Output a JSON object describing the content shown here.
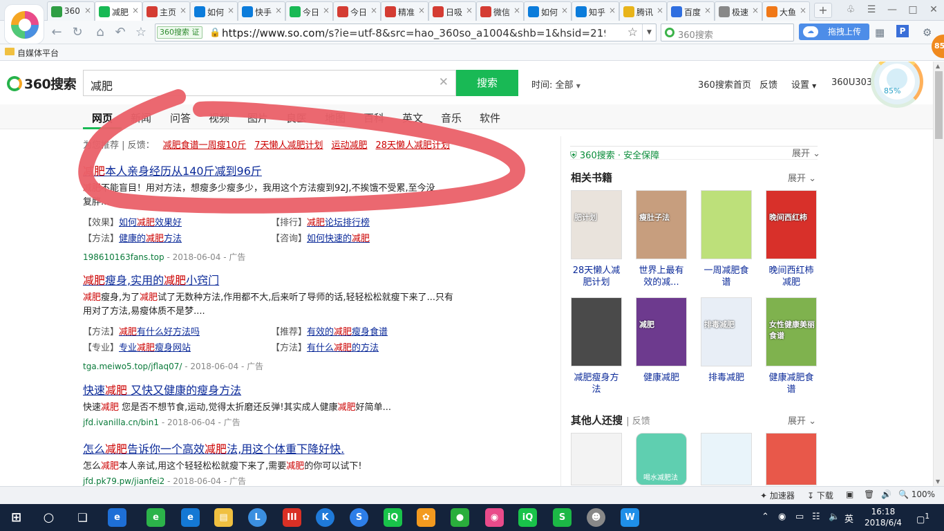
{
  "browser": {
    "tabs": [
      {
        "label": "360",
        "icon": "360-shield-icon",
        "color": "#2f9e44"
      },
      {
        "label": "减肥",
        "icon": "360-search-icon",
        "color": "#19b955",
        "active": true
      },
      {
        "label": "主页",
        "icon": "toutiao-icon",
        "color": "#d43c33"
      },
      {
        "label": "如何",
        "icon": "zhihu-icon",
        "color": "#0b7cdb"
      },
      {
        "label": "快手",
        "icon": "zhihu-icon",
        "color": "#0b7cdb"
      },
      {
        "label": "今日",
        "icon": "360-search-icon",
        "color": "#19b955"
      },
      {
        "label": "今日",
        "icon": "toutiao-icon",
        "color": "#d43c33"
      },
      {
        "label": "精准",
        "icon": "toutiao-icon",
        "color": "#d43c33"
      },
      {
        "label": "日吸",
        "icon": "toutiao-icon",
        "color": "#d43c33"
      },
      {
        "label": "微信",
        "icon": "toutiao-icon",
        "color": "#d43c33"
      },
      {
        "label": "如何",
        "icon": "zhihu-icon",
        "color": "#0b7cdb"
      },
      {
        "label": "知乎",
        "icon": "zhihu-icon",
        "color": "#0b7cdb"
      },
      {
        "label": "腾讯",
        "icon": "qq-icon",
        "color": "#e8b41a"
      },
      {
        "label": "百度",
        "icon": "baidu-icon",
        "color": "#2f6ee0"
      },
      {
        "label": "极速",
        "icon": "page-icon",
        "color": "#888888"
      },
      {
        "label": "大鱼",
        "icon": "dayu-icon",
        "color": "#f07818"
      }
    ],
    "new_tab": "+",
    "address": {
      "badge": "360搜索 证",
      "url_prefix": "https://www.so.com",
      "url_rest": "/s?ie=utf-8&src=hao_360so_a1004&shb=1&hsid=219d8"
    },
    "search_placeholder": "360搜索",
    "upload_label": "拖拽上传",
    "bookmark_label": "自媒体平台",
    "orange_badge": "85"
  },
  "search": {
    "logo_text": "360搜索",
    "query": "减肥",
    "button": "搜索",
    "time_label": "时间:",
    "time_value": "全部",
    "links": [
      "360搜索首页",
      "反馈",
      "设置",
      "360U3036..."
    ],
    "assistant_pct": "85%",
    "tabs": [
      "网页",
      "新闻",
      "问答",
      "视频",
      "图片",
      "良医",
      "地图",
      "百科",
      "英文",
      "音乐",
      "软件"
    ],
    "related_prefix": "为您推荐 | 反馈：",
    "related": [
      "减肥食谱一周瘦10斤",
      "7天懒人减肥计划",
      "运动减肥",
      "28天懒人减肥计划"
    ]
  },
  "results": [
    {
      "title": "减肥本人亲身经历从140斤减到96斤",
      "desc": "减肥不能盲目！用对方法，想瘦多少瘦多少，我用这个方法瘦到92J,不挨饿不受累,至今没",
      "desc2": "复胖...",
      "subs": [
        {
          "tag": "【效果】",
          "text": "如何减肥效果好"
        },
        {
          "tag": "【排行】",
          "text": "减肥论坛排行榜"
        },
        {
          "tag": "【方法】",
          "text": "健康的减肥方法"
        },
        {
          "tag": "【咨询】",
          "text": "如何快速的减肥"
        }
      ],
      "url": "198610163fans.top",
      "date": "- 2018-06-04",
      "ad": "- 广告"
    },
    {
      "title": "减肥瘦身,实用的减肥小窍门",
      "desc": "减肥瘦身,为了减肥试了无数种方法,作用都不大,后来听了导师的话,轻轻松松就瘦下来了...只有",
      "desc2": "用对了方法,易瘦体质不是梦....",
      "subs": [
        {
          "tag": "【方法】",
          "text": "减肥有什么好方法吗"
        },
        {
          "tag": "【推荐】",
          "text": "有效的减肥瘦身食谱"
        },
        {
          "tag": "【专业】",
          "text": "专业减肥瘦身网站"
        },
        {
          "tag": "【方法】",
          "text": "有什么减肥的方法"
        }
      ],
      "url": "tga.meiwo5.top/jflaq07/",
      "date": "- 2018-06-04",
      "ad": "- 广告"
    },
    {
      "title": "快速减肥 又快又健康的瘦身方法",
      "desc": "快速减肥 您是否不想节食,运动,觉得太折磨还反弹!其实成人健康减肥好简单...",
      "url": "jfd.ivanilla.cn/bin1",
      "date": "- 2018-06-04",
      "ad": "- 广告"
    },
    {
      "title": "怎么减肥告诉你一个高效减肥法,用这个体重下降好快.",
      "desc": "怎么减肥本人亲试,用这个轻轻松松就瘦下来了,需要减肥的你可以试下!",
      "url": "jfd.pk79.pw/jianfei2",
      "date": "- 2018-06-04",
      "ad": "- 广告"
    }
  ],
  "sidebar": {
    "safety": "360搜索 · 安全保障",
    "expand": "展开",
    "books_title": "相关书籍",
    "books": [
      {
        "title": "28天懒人减肥计划",
        "cover_text": "肥计划",
        "bg": "#e9e3dc"
      },
      {
        "title": "世界上最有效的减...",
        "cover_text": "瘦肚子法",
        "bg": "#c79e7e"
      },
      {
        "title": "一周减肥食谱",
        "cover_text": "",
        "bg": "#bde07a"
      },
      {
        "title": "晚间西红柿减肥",
        "cover_text": "晚间西红柿",
        "bg": "#d8302a"
      },
      {
        "title": "减肥瘦身方法",
        "cover_text": "",
        "bg": "#4a4a4a"
      },
      {
        "title": "健康减肥",
        "cover_text": "减肥",
        "bg": "#6d3a8e"
      },
      {
        "title": "排毒减肥",
        "cover_text": "排毒减肥",
        "bg": "#e8eef6"
      },
      {
        "title": "健康减肥食谱",
        "cover_text": "女性健康美丽食谱",
        "bg": "#7fb24e"
      }
    ],
    "others_title": "其他人还搜",
    "others_feedback": "| 反馈",
    "others": [
      {
        "label": "",
        "bg": "#f3f3f3"
      },
      {
        "label": "喝水减肥法",
        "bg": "#5fcfb0"
      },
      {
        "label": "",
        "bg": "#e9f4fa"
      },
      {
        "label": "",
        "bg": "#e8584a"
      }
    ]
  },
  "statusbar": {
    "accel": "加速器",
    "download": "下载",
    "zoom": "100%"
  },
  "taskbar": {
    "lang": "英",
    "time": "16:18",
    "date": "2018/6/4",
    "notif": "1"
  }
}
